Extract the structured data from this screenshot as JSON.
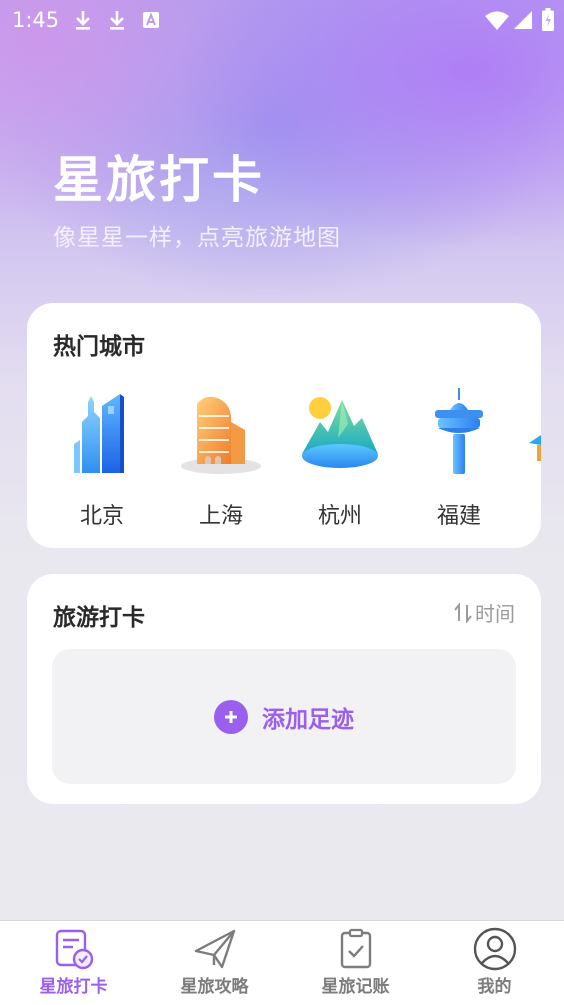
{
  "status_bar": {
    "time": "1:45"
  },
  "hero": {
    "title": "星旅打卡",
    "subtitle": "像星星一样，点亮旅游地图"
  },
  "hot_cities": {
    "title": "热门城市",
    "cities": [
      {
        "name": "北京",
        "icon": "skyscraper-icon"
      },
      {
        "name": "上海",
        "icon": "building-icon"
      },
      {
        "name": "杭州",
        "icon": "mountain-lake-icon"
      },
      {
        "name": "福建",
        "icon": "tower-icon"
      }
    ]
  },
  "travel_checkin": {
    "title": "旅游打卡",
    "sort_label": "时间",
    "add_label": "添加足迹"
  },
  "tab_bar": {
    "tabs": [
      {
        "label": "星旅打卡",
        "icon": "checkin-icon",
        "active": true
      },
      {
        "label": "星旅攻略",
        "icon": "paper-plane-icon",
        "active": false
      },
      {
        "label": "星旅记账",
        "icon": "ledger-icon",
        "active": false
      },
      {
        "label": "我的",
        "icon": "user-icon",
        "active": false
      }
    ]
  },
  "colors": {
    "accent": "#9b5ff0",
    "card": "#ffffff",
    "background": "#e9e9ee"
  }
}
